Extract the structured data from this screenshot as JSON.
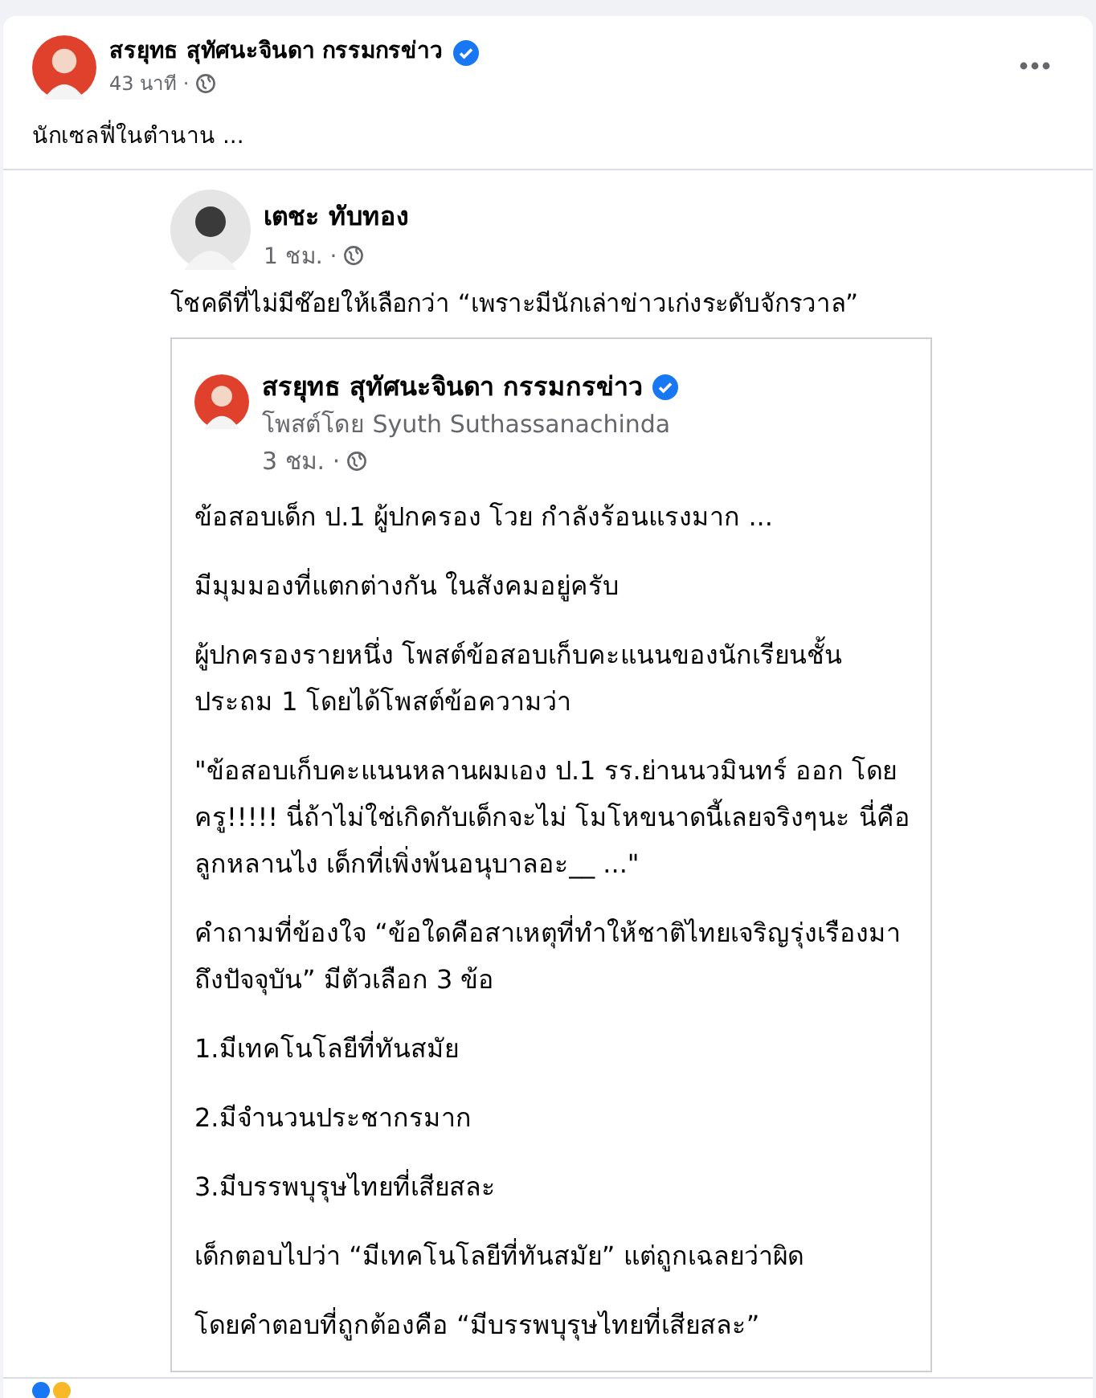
{
  "post": {
    "author": {
      "name": "สรยุทธ สุทัศนะจินดา กรรมกรข่าว",
      "verified": true
    },
    "time": "43 นาที ·",
    "text": "นักเซลฟี่ในตำนาน ...",
    "shared_image": {
      "author": {
        "name": "เตชะ ทับทอง"
      },
      "time": "1 ชม. ·",
      "text": "โชคดีที่ไม่มีช๊อยให้เลือกว่า “เพราะมีนักเล่าข่าวเก่งระดับจักรวาล”",
      "quoted_post": {
        "author": {
          "name": "สรยุทธ สุทัศนะจินดา กรรมกรข่าว",
          "verified": true
        },
        "posted_by": "โพสต์โดย Syuth Suthassanachinda",
        "time": "3 ชม. ·",
        "paragraphs": [
          "ข้อสอบเด็ก ป.1 ผู้ปกครอง โวย กำลังร้อนแรงมาก ...",
          "มีมุมมองที่แตกต่างกัน ในสังคมอยู่ครับ",
          "ผู้ปกครองรายหนึ่ง  โพสต์ข้อสอบเก็บคะแนนของนักเรียนชั้นประถม 1 โดยได้โพสต์ข้อความว่า",
          "\"ข้อสอบเก็บคะแนนหลานผมเอง ป.1 รร.ย่านนวมินทร์ ออก โดยครู!!!!! นี่ถ้าไม่ใช่เกิดกับเด็กจะไม่ โมโหขนาดนี้เลยจริงๆนะ นี่คือลูกหลานไง เด็กที่เพิ่งพ้นอนุบาลอะ__ ...\"",
          "คำถามที่ข้องใจ  “ข้อใดคือสาเหตุที่ทำให้ชาติไทยเจริญรุ่งเรืองมาถึงปัจจุบัน” มีตัวเลือก 3 ข้อ",
          "1.มีเทคโนโลยีที่ทันสมัย",
          "2.มีจำนวนประชากรมาก",
          "3.มีบรรพบุรุษไทยที่เสียสละ",
          "เด็กตอบไปว่า “มีเทคโนโลยีที่ทันสมัย” แต่ถูกเฉลยว่าผิด",
          "โดยคำตอบที่ถูกต้องคือ “มีบรรพบุรุษไทยที่เสียสละ”"
        ]
      }
    }
  }
}
